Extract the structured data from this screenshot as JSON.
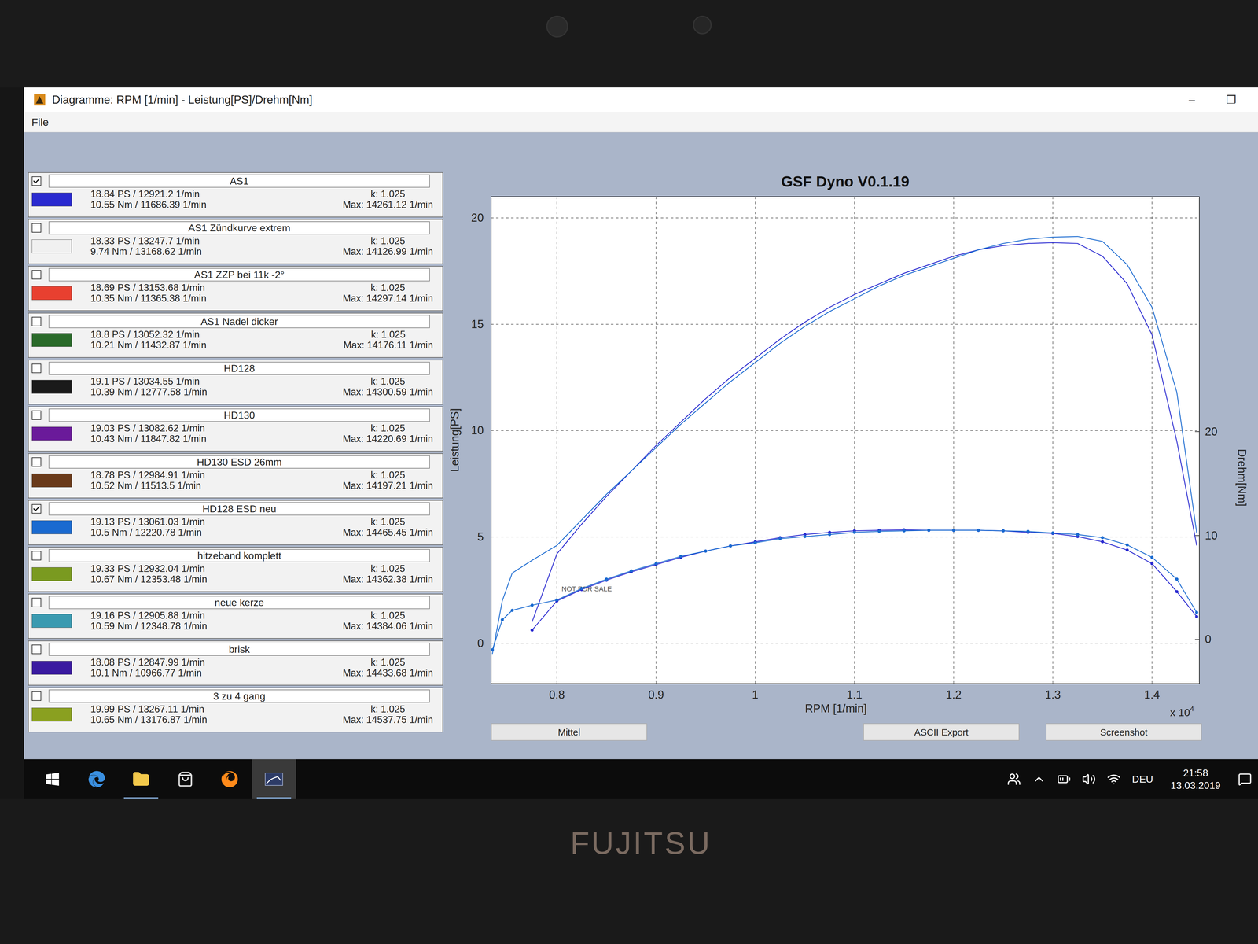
{
  "window": {
    "title": "Diagramme: RPM [1/min] - Leistung[PS]/Drehm[Nm]",
    "controls": [
      "–",
      "❐"
    ]
  },
  "menu": [
    "File"
  ],
  "legend": [
    {
      "name": "AS1",
      "checked": true,
      "color": "#2a2ad0",
      "power": "18.84 PS / 12921.2 1/min",
      "torque": "10.55 Nm / 11686.39 1/min",
      "k": "k: 1.025",
      "max": "Max: 14261.12 1/min"
    },
    {
      "name": "AS1 Zündkurve extrem",
      "checked": false,
      "color": "#f0f0f0",
      "power": "18.33 PS / 13247.7 1/min",
      "torque": "9.74 Nm / 13168.62 1/min",
      "k": "k: 1.025",
      "max": "Max: 14126.99 1/min"
    },
    {
      "name": "AS1 ZZP bei 11k -2°",
      "checked": false,
      "color": "#e84030",
      "power": "18.69 PS / 13153.68 1/min",
      "torque": "10.35 Nm / 11365.38 1/min",
      "k": "k: 1.025",
      "max": "Max: 14297.14 1/min"
    },
    {
      "name": "AS1 Nadel dicker",
      "checked": false,
      "color": "#2a6a2a",
      "power": "18.8 PS / 13052.32 1/min",
      "torque": "10.21 Nm / 11432.87 1/min",
      "k": "k: 1.025",
      "max": "Max: 14176.11 1/min"
    },
    {
      "name": "HD128",
      "checked": false,
      "color": "#1a1a1a",
      "power": "19.1 PS / 13034.55 1/min",
      "torque": "10.39 Nm / 12777.58 1/min",
      "k": "k: 1.025",
      "max": "Max: 14300.59 1/min"
    },
    {
      "name": "HD130",
      "checked": false,
      "color": "#6a1a9a",
      "power": "19.03 PS / 13082.62 1/min",
      "torque": "10.43 Nm / 11847.82 1/min",
      "k": "k: 1.025",
      "max": "Max: 14220.69 1/min"
    },
    {
      "name": "HD130 ESD 26mm",
      "checked": false,
      "color": "#6a3a1a",
      "power": "18.78 PS / 12984.91 1/min",
      "torque": "10.52 Nm / 11513.5 1/min",
      "k": "k: 1.025",
      "max": "Max: 14197.21 1/min"
    },
    {
      "name": "HD128 ESD neu",
      "checked": true,
      "color": "#1a6ad0",
      "power": "19.13 PS / 13061.03 1/min",
      "torque": "10.5 Nm / 12220.78 1/min",
      "k": "k: 1.025",
      "max": "Max: 14465.45 1/min"
    },
    {
      "name": "hitzeband komplett",
      "checked": false,
      "color": "#7a9a20",
      "power": "19.33 PS / 12932.04 1/min",
      "torque": "10.67 Nm / 12353.48 1/min",
      "k": "k: 1.025",
      "max": "Max: 14362.38 1/min"
    },
    {
      "name": "neue kerze",
      "checked": false,
      "color": "#3a9ab0",
      "power": "19.16 PS / 12905.88 1/min",
      "torque": "10.59 Nm / 12348.78 1/min",
      "k": "k: 1.025",
      "max": "Max: 14384.06 1/min"
    },
    {
      "name": "brisk",
      "checked": false,
      "color": "#3a1aa0",
      "power": "18.08 PS / 12847.99 1/min",
      "torque": "10.1 Nm / 10966.77 1/min",
      "k": "k: 1.025",
      "max": "Max: 14433.68 1/min"
    },
    {
      "name": "3 zu 4 gang",
      "checked": false,
      "color": "#8aa020",
      "power": "19.99 PS / 13267.11 1/min",
      "torque": "10.65 Nm / 13176.87 1/min",
      "k": "k: 1.025",
      "max": "Max: 14537.75 1/min"
    }
  ],
  "chart": {
    "title": "GSF Dyno V0.1.19",
    "x_label": "RPM [1/min]",
    "y_left_label": "Leistung[PS]",
    "y_right_label": "Drehm[Nm]",
    "x_ticks": [
      "0.8",
      "0.9",
      "1",
      "1.1",
      "1.2",
      "1.3",
      "1.4"
    ],
    "y_left_ticks": [
      "0",
      "5",
      "10",
      "15",
      "20"
    ],
    "y_right_ticks": [
      "0",
      "10",
      "20"
    ],
    "x_multiplier": "x 10",
    "x_exponent": "4",
    "watermark": "NOT FOR SALE",
    "series": [
      {
        "color": "#2a2ad0",
        "rpm": [
          7750,
          8000,
          8250,
          8500,
          8750,
          9000,
          9250,
          9500,
          9750,
          10000,
          10250,
          10500,
          10750,
          11000,
          11250,
          11500,
          11750,
          12000,
          12250,
          12500,
          12750,
          13000,
          13250,
          13500,
          13750,
          14000,
          14250,
          14450
        ],
        "power": [
          1.0,
          4.2,
          5.6,
          6.9,
          8.1,
          9.3,
          10.4,
          11.5,
          12.5,
          13.4,
          14.3,
          15.1,
          15.8,
          16.4,
          16.9,
          17.4,
          17.8,
          18.2,
          18.5,
          18.7,
          18.8,
          18.84,
          18.8,
          18.2,
          16.9,
          14.5,
          9.5,
          4.6
        ],
        "torque": [
          0.9,
          3.7,
          4.8,
          5.7,
          6.5,
          7.2,
          7.9,
          8.5,
          9.0,
          9.4,
          9.8,
          10.1,
          10.3,
          10.45,
          10.5,
          10.55,
          10.5,
          10.5,
          10.5,
          10.45,
          10.3,
          10.2,
          9.9,
          9.4,
          8.6,
          7.3,
          4.6,
          2.2
        ]
      },
      {
        "color": "#1a6ad0",
        "rpm": [
          7350,
          7450,
          7550,
          7750,
          8000,
          8250,
          8500,
          8750,
          9000,
          9250,
          9500,
          9750,
          10000,
          10250,
          10500,
          10750,
          11000,
          11250,
          11500,
          11750,
          12000,
          12250,
          12500,
          12750,
          13000,
          13250,
          13500,
          13750,
          14000,
          14250,
          14450
        ],
        "power": [
          -0.5,
          2.0,
          3.3,
          3.9,
          4.6,
          5.8,
          7.0,
          8.1,
          9.2,
          10.3,
          11.3,
          12.3,
          13.2,
          14.1,
          14.9,
          15.6,
          16.2,
          16.8,
          17.3,
          17.7,
          18.1,
          18.5,
          18.8,
          19.0,
          19.1,
          19.13,
          18.9,
          17.8,
          15.8,
          11.8,
          5.2
        ],
        "torque": [
          -1.0,
          1.9,
          2.8,
          3.3,
          3.8,
          4.9,
          5.8,
          6.6,
          7.3,
          8.0,
          8.5,
          9.0,
          9.3,
          9.7,
          9.9,
          10.1,
          10.3,
          10.4,
          10.45,
          10.5,
          10.5,
          10.5,
          10.45,
          10.4,
          10.25,
          10.1,
          9.8,
          9.1,
          7.9,
          5.8,
          2.6
        ]
      }
    ]
  },
  "buttons": [
    "Mittel",
    "ASCII Export",
    "Screenshot"
  ],
  "taskbar": {
    "apps": [
      {
        "kind": "start",
        "selected": false,
        "running": false
      },
      {
        "kind": "edge",
        "selected": false,
        "running": false
      },
      {
        "kind": "explorer",
        "selected": false,
        "running": true
      },
      {
        "kind": "store",
        "selected": false,
        "running": false
      },
      {
        "kind": "firefox",
        "selected": false,
        "running": false
      },
      {
        "kind": "dyno",
        "selected": true,
        "running": true
      }
    ],
    "language": "DEU",
    "time": "21:58",
    "date": "13.03.2019"
  },
  "bezel": {
    "brand": "FUJITSU"
  }
}
